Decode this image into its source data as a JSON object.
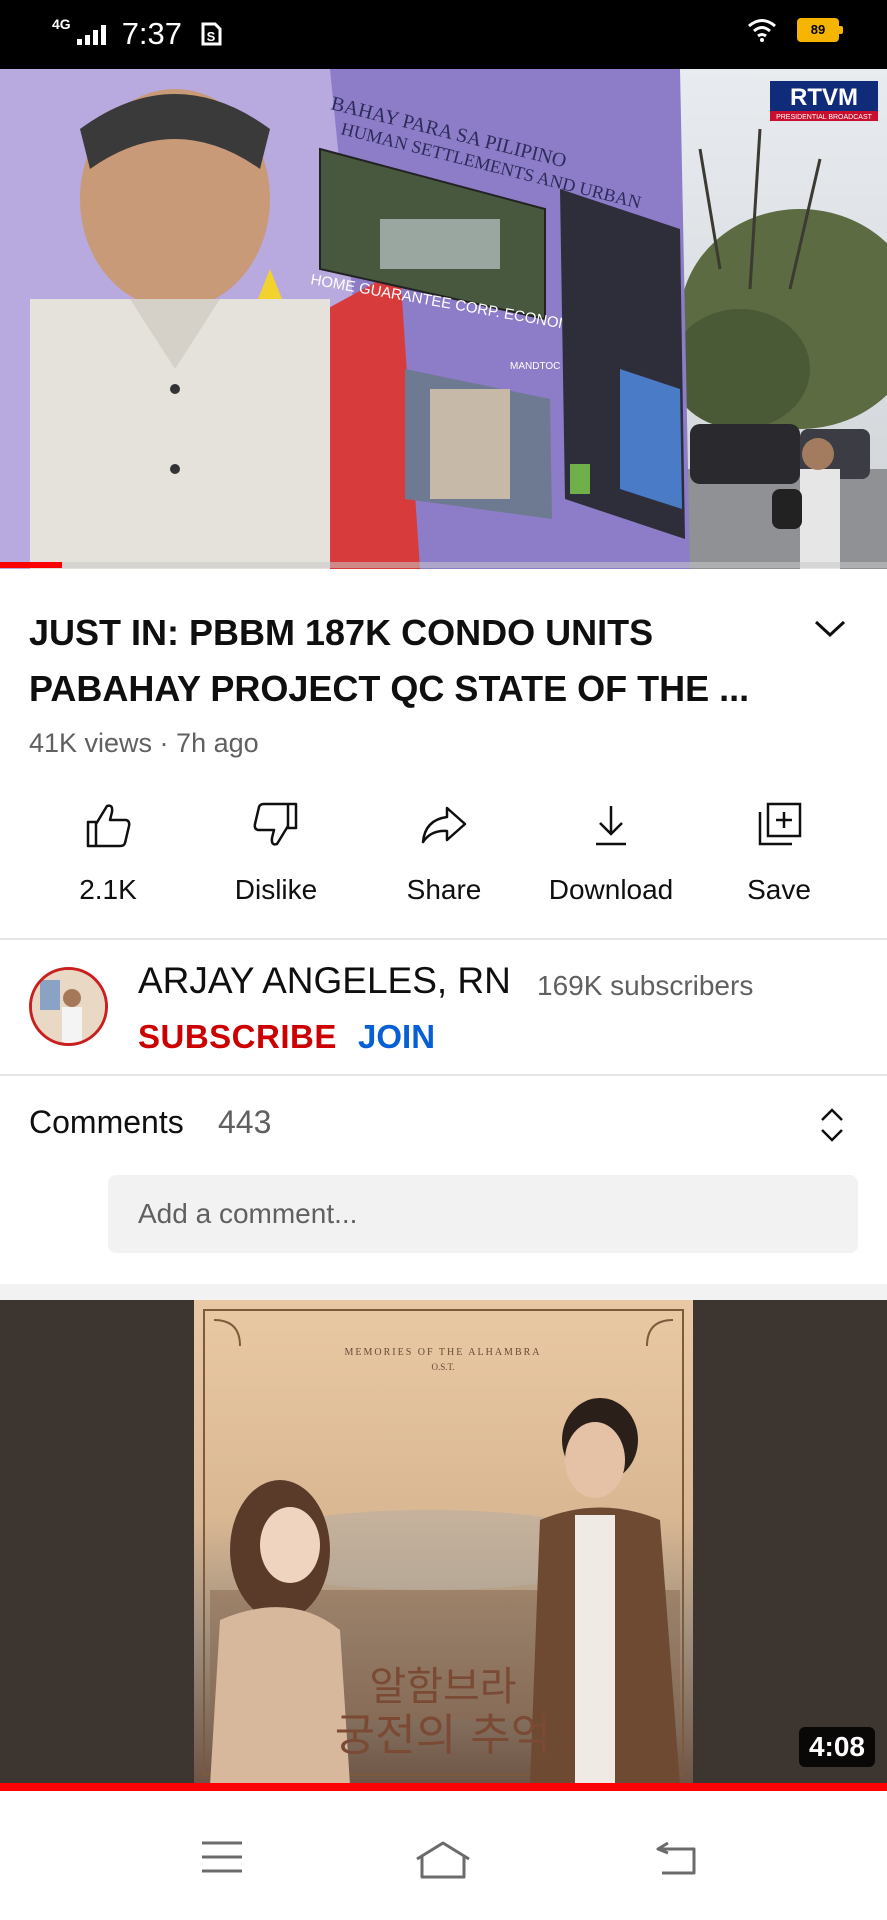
{
  "status_bar": {
    "network": "4G",
    "time": "7:37",
    "battery": "89"
  },
  "player": {
    "watermark": "RTVM",
    "watermark_sub": "PRESIDENTIAL BROADCAST",
    "billboard_line1": "BAHAY PARA SA PILIPINO",
    "billboard_line2": "HUMAN SETTLEMENTS AND URBAN",
    "billboard_label": "HOME GUARANTEE CORP. ECONOMIC ZONE",
    "billboard_label2": "MANDTOC",
    "progress": 0.07
  },
  "video": {
    "title": "JUST IN: PBBM 187K CONDO UNITS PABAHAY PROJECT QC STATE OF THE ...",
    "meta": "41K views · 7h ago"
  },
  "actions": {
    "like": "2.1K",
    "dislike": "Dislike",
    "share": "Share",
    "download": "Download",
    "save": "Save"
  },
  "channel": {
    "name": "ARJAY ANGELES, RN",
    "subscribers": "169K subscribers",
    "subscribe_label": "SUBSCRIBE",
    "join_label": "JOIN"
  },
  "comments": {
    "label": "Comments",
    "count": "443",
    "placeholder": "Add a comment..."
  },
  "next_video": {
    "poster_top": "MEMORIES OF THE ALHAMBRA",
    "poster_ost": "O.S.T.",
    "poster_title_1": "알함브라",
    "poster_title_2": "궁전의 추억",
    "duration": "4:08"
  },
  "colors": {
    "accent_red": "#ff0000",
    "subscribe_red": "#cc0000",
    "join_blue": "#065fd4"
  }
}
